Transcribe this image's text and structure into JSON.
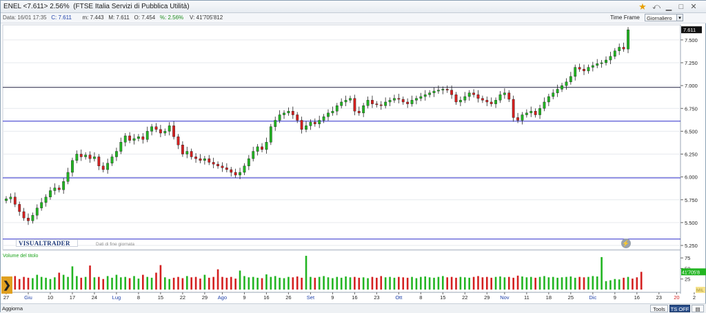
{
  "title": {
    "symbol": "ENEL <7.611> 2.56%",
    "name": "(FTSE Italia Servizi di Pubblica Utilità)"
  },
  "info": {
    "date": "Data: 16/01 17:35",
    "close": "C: 7.611",
    "low": "m: 7.443",
    "high": "M: 7.611",
    "open": "O: 7.454",
    "pct": "%: 2.56%",
    "volume": "V: 41'705'812"
  },
  "timeframe": {
    "label": "Time Frame",
    "value": "Giornaliero"
  },
  "price_tag": "7.611",
  "volume_tag": "41'705'8",
  "volume_label": "Volume del titolo",
  "logo": "VISUALTRADER",
  "eod_note": "Dati di fine giornata",
  "bottom": {
    "update": "Aggiorna",
    "tools": "Tools",
    "ts": "TS OFF"
  },
  "colors": {
    "up": "#22b522",
    "down": "#d42020",
    "hline": "#2b2bcc",
    "black_line": "#222244"
  },
  "chart_data": {
    "type": "candlestick",
    "y_ticks": [
      "7.500",
      "7.250",
      "7.000",
      "6.750",
      "6.500",
      "6.250",
      "6.000",
      "5.750",
      "5.500",
      "5.250"
    ],
    "ylim": [
      5.25,
      7.65
    ],
    "vol_ticks": [
      "75",
      "50",
      "25"
    ],
    "vol_extra_label": "MIL",
    "x_labels": [
      {
        "t": "27",
        "i": 0
      },
      {
        "t": "Giu",
        "i": 5,
        "blue": true
      },
      {
        "t": "10",
        "i": 10
      },
      {
        "t": "17",
        "i": 15
      },
      {
        "t": "24",
        "i": 20
      },
      {
        "t": "Lug",
        "i": 25,
        "blue": true
      },
      {
        "t": "8",
        "i": 30
      },
      {
        "t": "15",
        "i": 35
      },
      {
        "t": "22",
        "i": 40
      },
      {
        "t": "29",
        "i": 45
      },
      {
        "t": "Ago",
        "i": 49,
        "blue": true
      },
      {
        "t": "9",
        "i": 54
      },
      {
        "t": "16",
        "i": 59
      },
      {
        "t": "26",
        "i": 64
      },
      {
        "t": "Set",
        "i": 69,
        "blue": true
      },
      {
        "t": "9",
        "i": 74
      },
      {
        "t": "16",
        "i": 79
      },
      {
        "t": "23",
        "i": 84
      },
      {
        "t": "Ott",
        "i": 89,
        "blue": true
      },
      {
        "t": "8",
        "i": 94
      },
      {
        "t": "15",
        "i": 99
      },
      {
        "t": "22",
        "i": 104
      },
      {
        "t": "29",
        "i": 109
      },
      {
        "t": "Nov",
        "i": 113,
        "blue": true
      },
      {
        "t": "11",
        "i": 118
      },
      {
        "t": "18",
        "i": 123
      },
      {
        "t": "25",
        "i": 128
      },
      {
        "t": "Dic",
        "i": 133,
        "blue": true
      },
      {
        "t": "9",
        "i": 138
      },
      {
        "t": "16",
        "i": 143
      },
      {
        "t": "23",
        "i": 148
      },
      {
        "t": "20",
        "i": 152,
        "red": true
      },
      {
        "t": "2",
        "i": 156
      },
      {
        "t": "9",
        "i": 161
      },
      {
        "t": "16",
        "i": 166
      }
    ],
    "hlines": [
      {
        "y": 6.98,
        "color": "black"
      },
      {
        "y": 6.61,
        "color": "blue"
      },
      {
        "y": 5.99,
        "color": "blue"
      },
      {
        "y": 5.32,
        "color": "blue"
      }
    ],
    "close_series": [
      5.76,
      5.78,
      5.7,
      5.62,
      5.55,
      5.52,
      5.58,
      5.66,
      5.72,
      5.78,
      5.85,
      5.88,
      5.86,
      5.95,
      6.05,
      6.18,
      6.25,
      6.22,
      6.24,
      6.2,
      6.22,
      6.12,
      6.08,
      6.15,
      6.22,
      6.28,
      6.38,
      6.45,
      6.4,
      6.42,
      6.44,
      6.41,
      6.5,
      6.55,
      6.52,
      6.48,
      6.5,
      6.56,
      6.44,
      6.35,
      6.25,
      6.28,
      6.22,
      6.2,
      6.18,
      6.2,
      6.16,
      6.14,
      6.12,
      6.1,
      6.08,
      6.05,
      6.02,
      6.05,
      6.12,
      6.2,
      6.28,
      6.33,
      6.3,
      6.38,
      6.55,
      6.62,
      6.68,
      6.7,
      6.72,
      6.68,
      6.62,
      6.52,
      6.56,
      6.6,
      6.58,
      6.62,
      6.66,
      6.7,
      6.72,
      6.78,
      6.82,
      6.84,
      6.86,
      6.72,
      6.7,
      6.78,
      6.84,
      6.8,
      6.79,
      6.78,
      6.82,
      6.84,
      6.86,
      6.85,
      6.82,
      6.8,
      6.84,
      6.86,
      6.88,
      6.9,
      6.92,
      6.94,
      6.95,
      6.96,
      6.95,
      6.9,
      6.82,
      6.84,
      6.88,
      6.92,
      6.9,
      6.86,
      6.84,
      6.82,
      6.8,
      6.84,
      6.9,
      6.92,
      6.85,
      6.65,
      6.62,
      6.68,
      6.7,
      6.72,
      6.68,
      6.75,
      6.82,
      6.88,
      6.92,
      6.96,
      7.0,
      7.04,
      7.1,
      7.2,
      7.18,
      7.16,
      7.2,
      7.22,
      7.24,
      7.25,
      7.28,
      7.32,
      7.38,
      7.42,
      7.4,
      7.611
    ],
    "volume_series": [
      30,
      28,
      32,
      25,
      30,
      28,
      27,
      35,
      30,
      28,
      25,
      29,
      40,
      35,
      30,
      55,
      32,
      28,
      30,
      57,
      29,
      30,
      25,
      32,
      28,
      35,
      29,
      30,
      27,
      32,
      26,
      35,
      30,
      28,
      40,
      58,
      29,
      25,
      28,
      30,
      27,
      32,
      29,
      30,
      26,
      35,
      28,
      30,
      48,
      30,
      28,
      30,
      26,
      45,
      32,
      29,
      30,
      28,
      27,
      36,
      30,
      32,
      28,
      27,
      30,
      29,
      31,
      28,
      80,
      30,
      28,
      30,
      32,
      29,
      27,
      30,
      28,
      31,
      29,
      30,
      28,
      29,
      27,
      30,
      28,
      32,
      29,
      30,
      28,
      30,
      29,
      28,
      30,
      27,
      30,
      31,
      29,
      28,
      30,
      32,
      29,
      30,
      28,
      30,
      29,
      28,
      30,
      32,
      29,
      30,
      28,
      30,
      31,
      29,
      30,
      28,
      33,
      31,
      29,
      30,
      28,
      30,
      32,
      29,
      30,
      28,
      29,
      30,
      31,
      28,
      30,
      29,
      30,
      32,
      31,
      77,
      20,
      22,
      25,
      24,
      28,
      30,
      26,
      29,
      42
    ]
  }
}
